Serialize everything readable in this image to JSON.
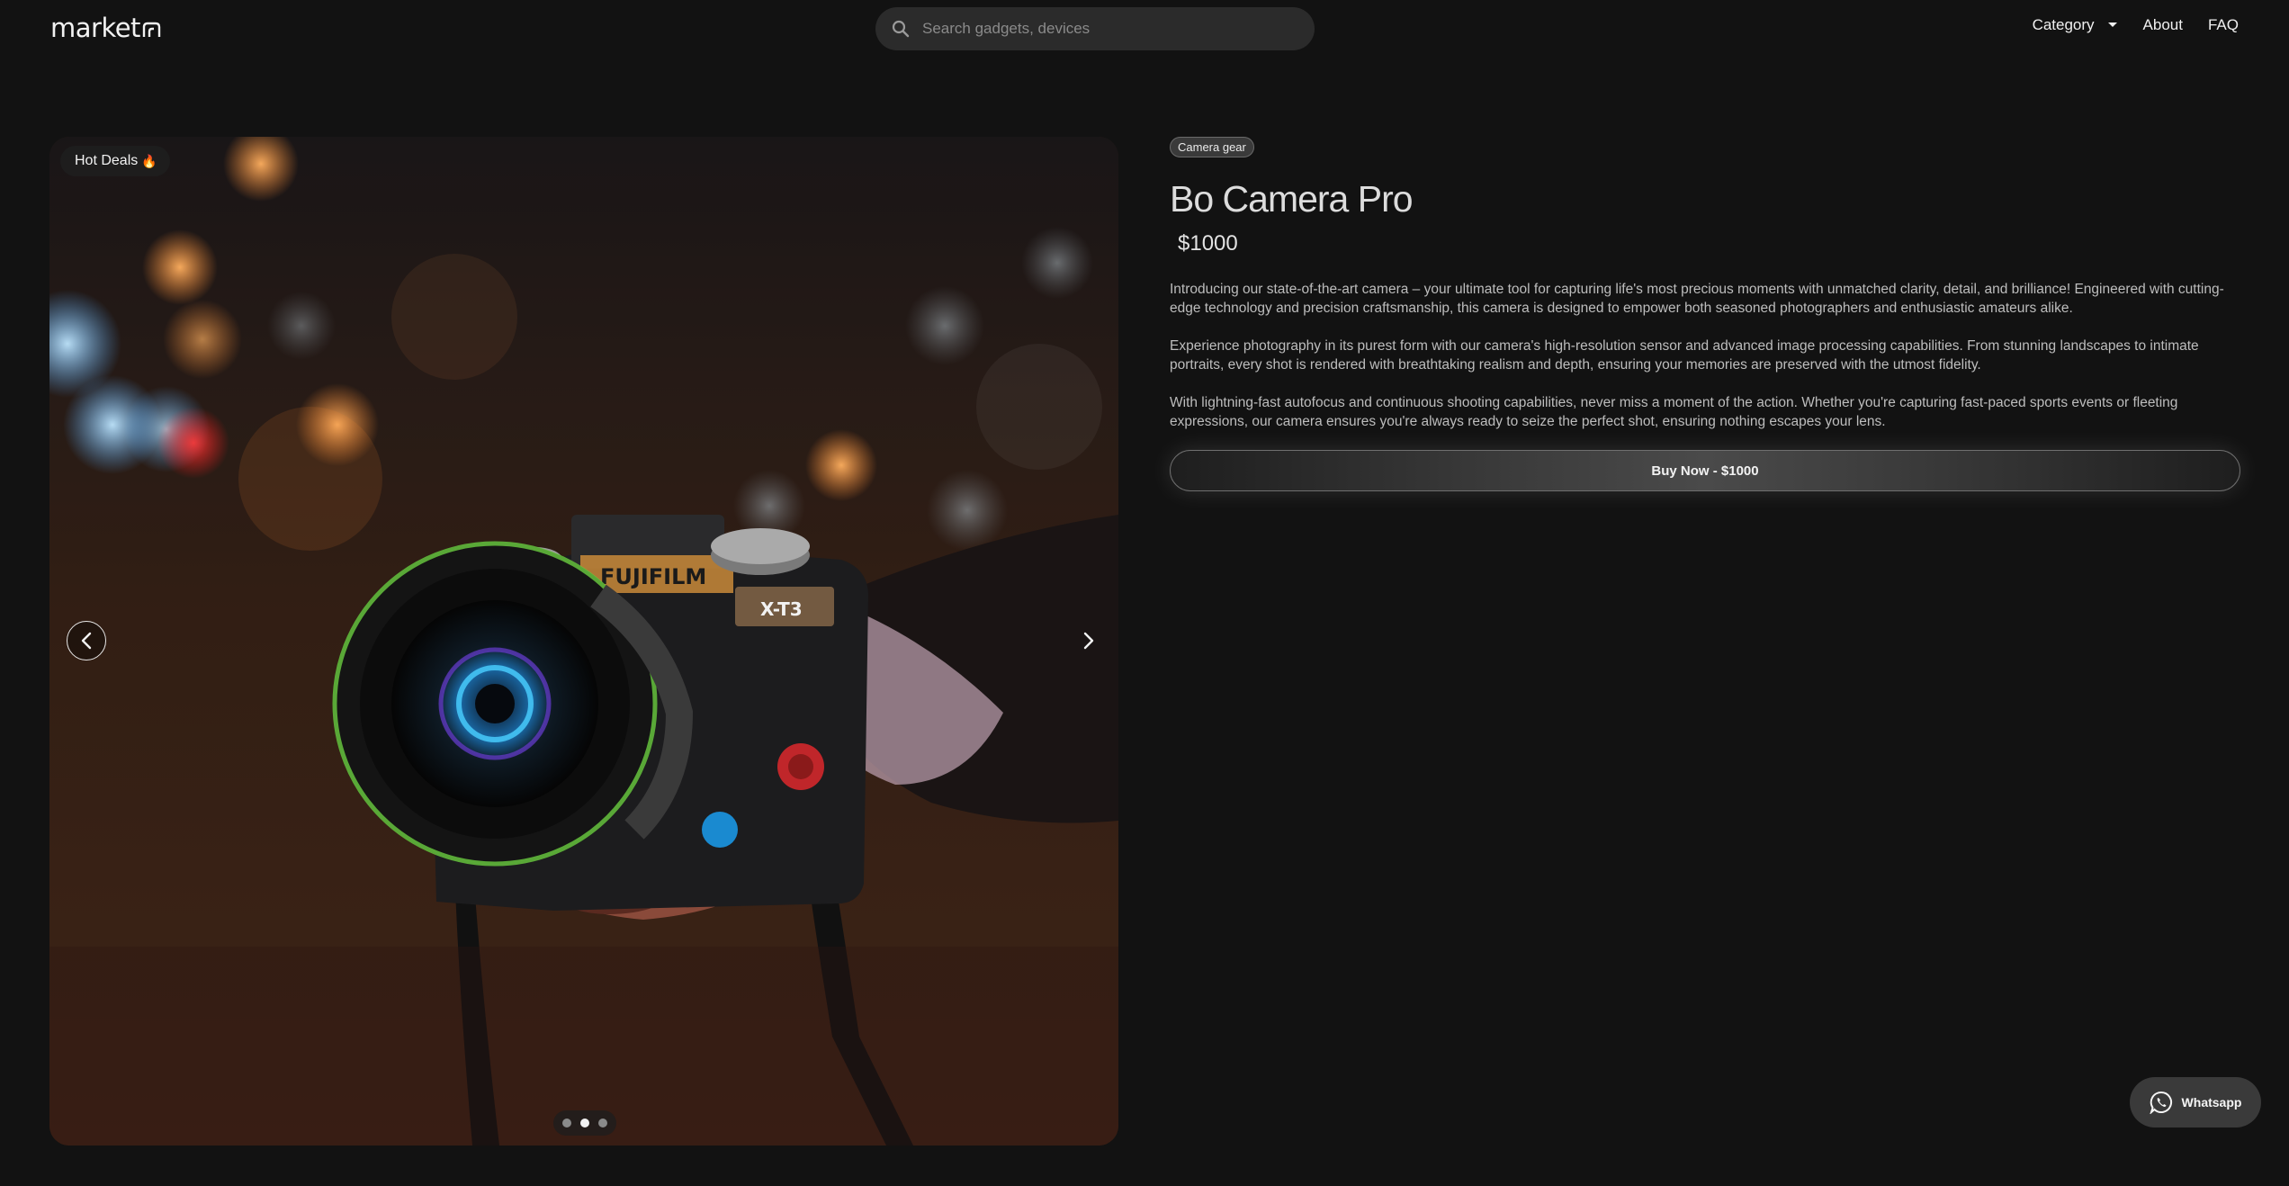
{
  "header": {
    "logo_text": "market",
    "search_placeholder": "Search gadgets, devices",
    "nav": {
      "category": "Category",
      "about": "About",
      "faq": "FAQ"
    }
  },
  "gallery": {
    "badge_text": "Hot Deals",
    "badge_emoji": "🔥",
    "slide_count": 3,
    "active_slide": 2,
    "image_subject": "Fujifilm X-T3 camera held in hand, night street bokeh",
    "camera_brand_text": "FUJIFILM",
    "camera_model_text": "X-T3"
  },
  "product": {
    "category_tag": "Camera gear",
    "title": "Bo Camera Pro",
    "price": "$1000",
    "description": [
      "Introducing our state-of-the-art camera – your ultimate tool for capturing life's most precious moments with unmatched clarity, detail, and brilliance! Engineered with cutting-edge technology and precision craftsmanship, this camera is designed to empower both seasoned photographers and enthusiastic amateurs alike.",
      "Experience photography in its purest form with our camera's high-resolution sensor and advanced image processing capabilities. From stunning landscapes to intimate portraits, every shot is rendered with breathtaking realism and depth, ensuring your memories are preserved with the utmost fidelity.",
      "With lightning-fast autofocus and continuous shooting capabilities, never miss a moment of the action. Whether you're capturing fast-paced sports events or fleeting expressions, our camera ensures you're always ready to seize the perfect shot, ensuring nothing escapes your lens."
    ],
    "buy_label": "Buy Now - $1000"
  },
  "whatsapp": {
    "label": "Whatsapp"
  },
  "colors": {
    "background": "#121212",
    "search_bg": "#2b2b2b",
    "accent_text": "#f2f2f2"
  }
}
